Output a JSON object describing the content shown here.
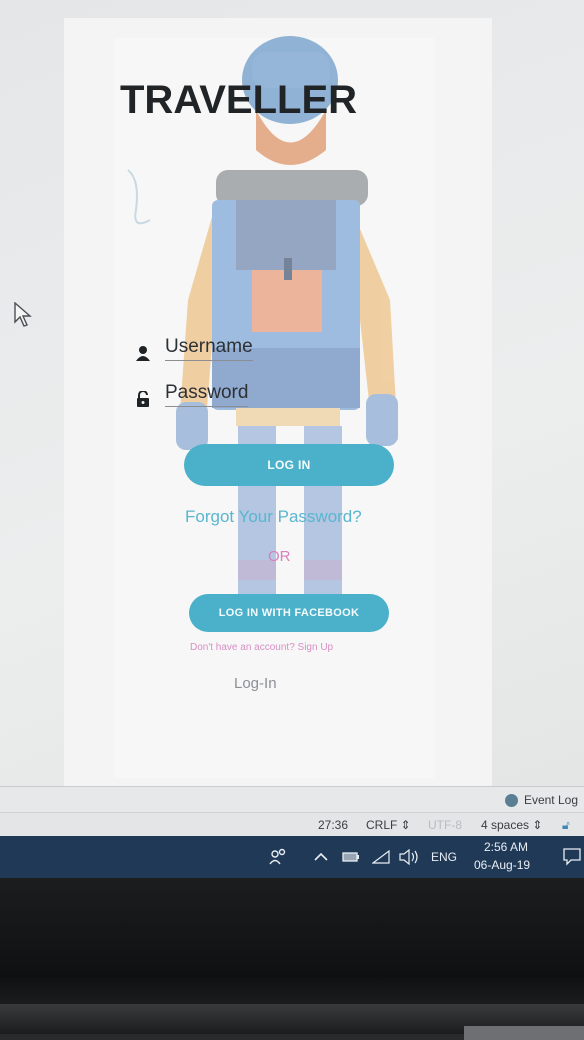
{
  "app": {
    "title": "TRAVELLER",
    "username_placeholder": "Username",
    "password_placeholder": "Password",
    "login_button": "LOG IN",
    "forgot_password": "Forgot Your Password?",
    "or_text": "OR",
    "facebook_button": "LOG IN WITH FACEBOOK",
    "signup_text": "Don't have an account? Sign Up",
    "login_link": "Log-In",
    "icons": {
      "username": "person-icon",
      "password": "lock-icon"
    },
    "colors": {
      "accent": "#4bb0c9",
      "link": "#5ab6cf",
      "pink": "#d97fbd",
      "title": "#202427"
    }
  },
  "ide": {
    "event_log": "Event Log",
    "cursor_position": "27:36",
    "line_ending": "CRLF",
    "encoding": "UTF-8",
    "indent": "4 spaces"
  },
  "taskbar": {
    "language": "ENG",
    "time": "2:56 AM",
    "date": "06-Aug-19",
    "icons": [
      "people-icon",
      "chevron-up-icon",
      "battery-icon",
      "wifi-icon",
      "volume-icon",
      "notification-icon"
    ]
  }
}
